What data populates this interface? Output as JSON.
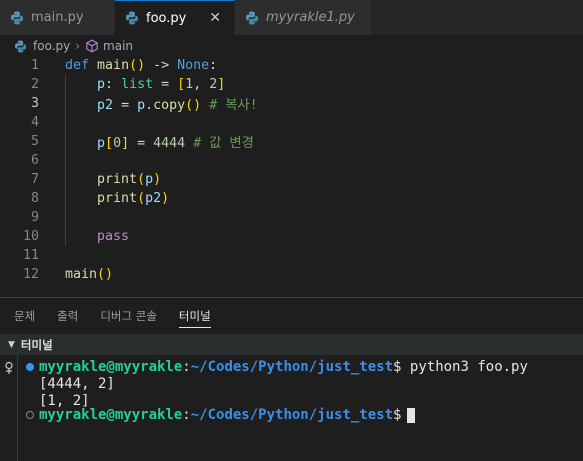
{
  "tabs": [
    {
      "label": "main.py",
      "italic": false,
      "active": false
    },
    {
      "label": "foo.py",
      "italic": false,
      "active": true
    },
    {
      "label": "myyrakle1.py",
      "italic": true,
      "active": false
    }
  ],
  "close_glyph": "✕",
  "breadcrumb": {
    "file": "foo.py",
    "symbol": "main"
  },
  "editor": {
    "current_line": 3,
    "line_numbers": [
      "1",
      "2",
      "3",
      "4",
      "5",
      "6",
      "7",
      "8",
      "9",
      "10",
      "11",
      "12"
    ]
  },
  "panel": {
    "tabs": [
      "문제",
      "출력",
      "디버그 콘솔",
      "터미널"
    ],
    "active_tab": "터미널",
    "terminal_header": "터미널"
  },
  "terminal": {
    "user": "myyrakle@myyrakle",
    "path": "~/Codes/Python/just_test",
    "prompt": "$",
    "command": "python3 foo.py",
    "output": [
      "[4444, 2]",
      "[1, 2]"
    ]
  },
  "colors": {
    "accent": "#0e7fd6",
    "terminal_user": "#23d18b",
    "terminal_path": "#3b8eea",
    "status_dot": "#3794ff"
  },
  "icons": {
    "python": "python-file-icon",
    "symbol": "method-cube-icon",
    "chevron": "chevron-down-icon",
    "terminal_gutter": "terminal-decoration-icon"
  }
}
